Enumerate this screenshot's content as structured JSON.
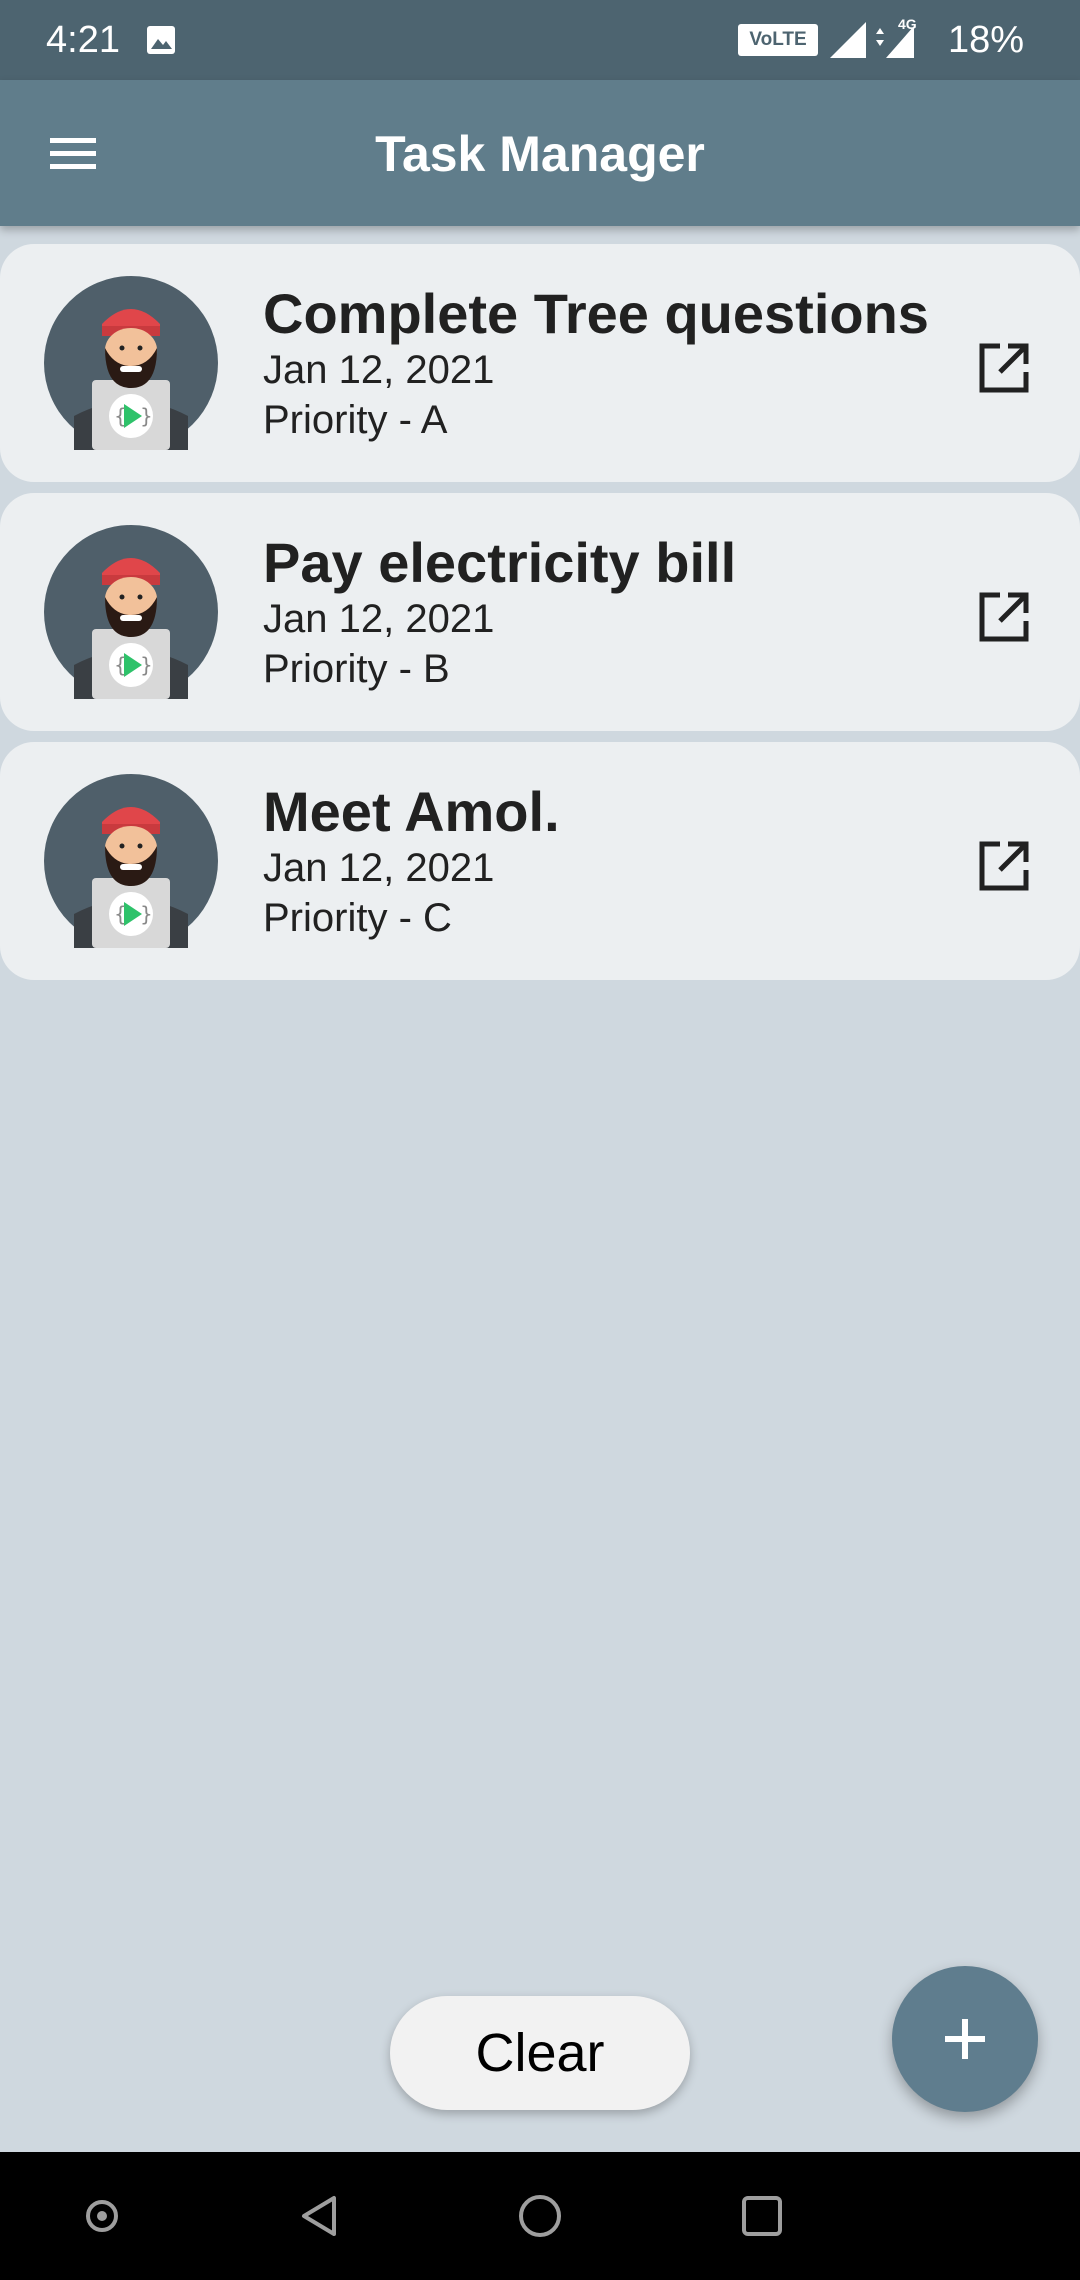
{
  "status_bar": {
    "time": "4:21",
    "volte_label": "VoLTE",
    "network_label": "4G",
    "battery": "18%"
  },
  "app_bar": {
    "title": "Task Manager",
    "menu_icon": "hamburger-menu-icon"
  },
  "tasks": [
    {
      "title": "Complete Tree questions",
      "date": "Jan 12, 2021",
      "priority": "Priority - A"
    },
    {
      "title": "Pay electricity bill",
      "date": "Jan 12, 2021",
      "priority": "Priority - B"
    },
    {
      "title": "Meet Amol.",
      "date": "Jan 12, 2021",
      "priority": "Priority - C"
    }
  ],
  "actions": {
    "clear_label": "Clear",
    "add_icon": "plus-icon"
  },
  "colors": {
    "app_bar": "#607d8b",
    "status_bar": "#4d6470",
    "background": "#cfd8df",
    "card": "#eceff1",
    "fab": "#5f7d8e"
  }
}
